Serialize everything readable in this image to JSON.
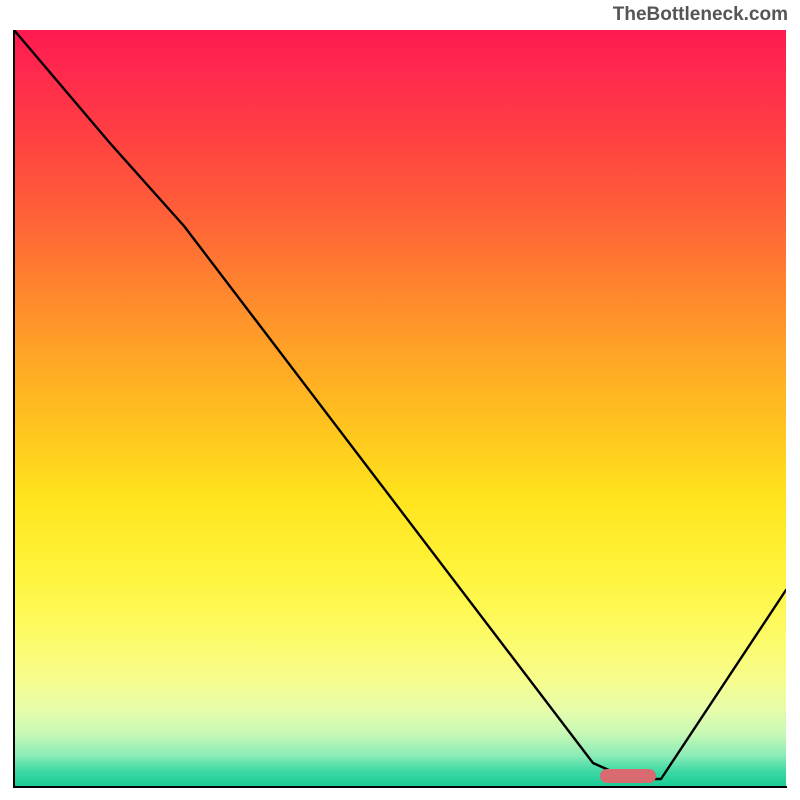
{
  "watermark": "TheBottleneck.com",
  "chart_data": {
    "type": "line",
    "title": "",
    "xlabel": "",
    "ylabel": "",
    "xlim": [
      0,
      100
    ],
    "ylim": [
      0,
      100
    ],
    "background": "vertical_gradient",
    "gradient_stops": [
      {
        "pos": 0,
        "color": "#ff1a51"
      },
      {
        "pos": 50,
        "color": "#ffb020"
      },
      {
        "pos": 80,
        "color": "#fdfb66"
      },
      {
        "pos": 100,
        "color": "#19cb96"
      }
    ],
    "series": [
      {
        "name": "bottleneck_curve",
        "color": "#000000",
        "x": [
          0,
          12,
          22,
          75,
          80,
          84,
          100
        ],
        "y": [
          100,
          85,
          74,
          3,
          1,
          1,
          26
        ]
      }
    ],
    "marker": {
      "x": 78,
      "y": 1.5,
      "width": 7,
      "height": 2,
      "color": "#d96a6f"
    },
    "axes_visible": false,
    "grid": false
  }
}
